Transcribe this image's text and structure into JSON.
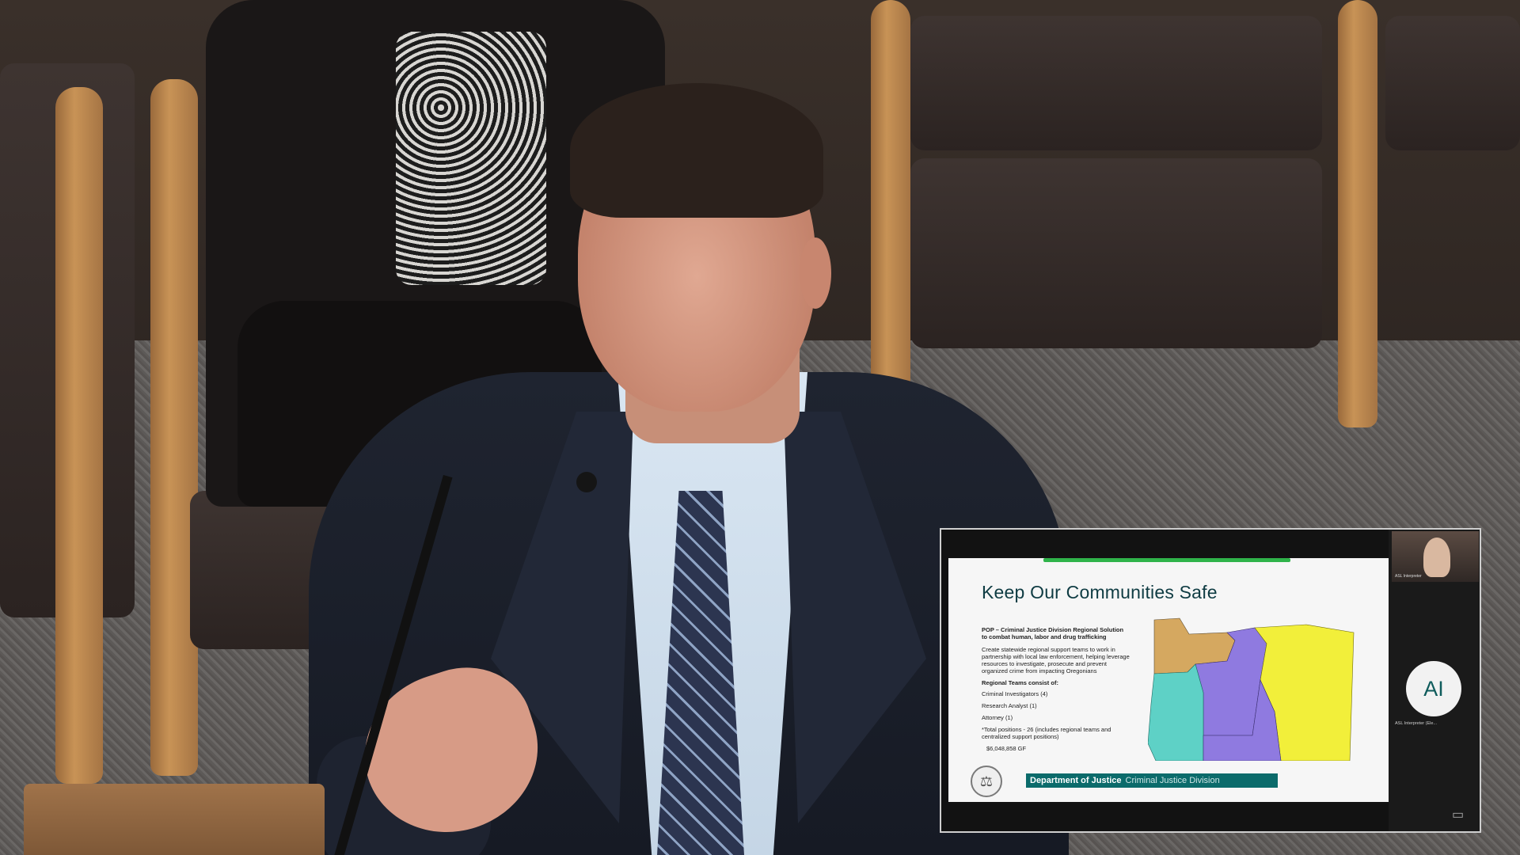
{
  "slide": {
    "title": "Keep Our Communities Safe",
    "heading": "POP – Criminal Justice Division Regional Solution to combat human, labor and drug trafficking",
    "paragraph": "Create statewide regional support teams to work in partnership with local law enforcement, helping leverage resources to investigate, prosecute and prevent organized crime from impacting Oregonians",
    "teams_heading": "Regional Teams consist of:",
    "team_items": [
      "Criminal Investigators (4)",
      "Research Analyst (1)",
      "Attorney (1)"
    ],
    "total_positions": "*Total positions - 26 (includes regional teams and centralized support positions)",
    "amount": "$6,048,858 GF",
    "footer_org": "Department of Justice",
    "footer_division": "Criminal Justice Division",
    "seal_glyph": "⚖"
  },
  "side_panel": {
    "interpreter_caption": "ASL Interpreter",
    "avatar_initials": "AI",
    "avatar_caption": "ASL Interpreter (Ele...",
    "corner_icon": "screen-share-icon"
  },
  "colors": {
    "title": "#0f3c43",
    "footer_bar": "#0b6b6b",
    "map_region_1": "#d5a860",
    "map_region_2": "#8f7ae0",
    "map_region_3": "#f2ef3a",
    "map_region_4": "#5ed1c6"
  }
}
